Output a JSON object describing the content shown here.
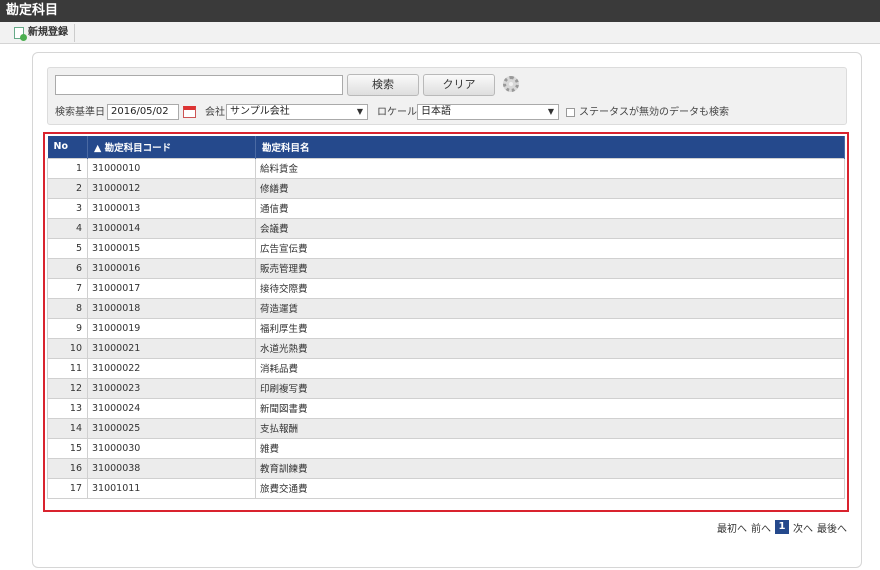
{
  "app": {
    "title": "勘定科目"
  },
  "toolbar": {
    "new_label": "新規登録"
  },
  "search": {
    "keyword_value": "",
    "search_button": "検索",
    "clear_button": "クリア",
    "base_date_label": "検索基準日",
    "base_date_value": "2016/05/02",
    "company_label": "会社",
    "company_value": "サンプル会社",
    "locale_label": "ロケール",
    "locale_value": "日本語",
    "include_invalid_label": "ステータスが無効のデータも検索"
  },
  "table": {
    "headers": {
      "no": "No",
      "code": "▲ 勘定科目コード",
      "name": "勘定科目名"
    },
    "rows": [
      {
        "no": "1",
        "code": "31000010",
        "name": "給料賃金"
      },
      {
        "no": "2",
        "code": "31000012",
        "name": "修繕費"
      },
      {
        "no": "3",
        "code": "31000013",
        "name": "通信費"
      },
      {
        "no": "4",
        "code": "31000014",
        "name": "会議費"
      },
      {
        "no": "5",
        "code": "31000015",
        "name": "広告宣伝費"
      },
      {
        "no": "6",
        "code": "31000016",
        "name": "販売管理費"
      },
      {
        "no": "7",
        "code": "31000017",
        "name": "接待交際費"
      },
      {
        "no": "8",
        "code": "31000018",
        "name": "荷造運賃"
      },
      {
        "no": "9",
        "code": "31000019",
        "name": "福利厚生費"
      },
      {
        "no": "10",
        "code": "31000021",
        "name": "水道光熱費"
      },
      {
        "no": "11",
        "code": "31000022",
        "name": "消耗品費"
      },
      {
        "no": "12",
        "code": "31000023",
        "name": "印刷複写費"
      },
      {
        "no": "13",
        "code": "31000024",
        "name": "新聞図書費"
      },
      {
        "no": "14",
        "code": "31000025",
        "name": "支払報酬"
      },
      {
        "no": "15",
        "code": "31000030",
        "name": "雑費"
      },
      {
        "no": "16",
        "code": "31000038",
        "name": "教育訓練費"
      },
      {
        "no": "17",
        "code": "31001011",
        "name": "旅費交通費"
      }
    ]
  },
  "pager": {
    "first": "最初へ",
    "prev": "前へ",
    "current": "1",
    "next": "次へ",
    "last": "最後へ"
  },
  "colors": {
    "header_bg": "#25498c",
    "highlight_border": "#d9232e",
    "titlebar_bg": "#3a3a3a"
  }
}
